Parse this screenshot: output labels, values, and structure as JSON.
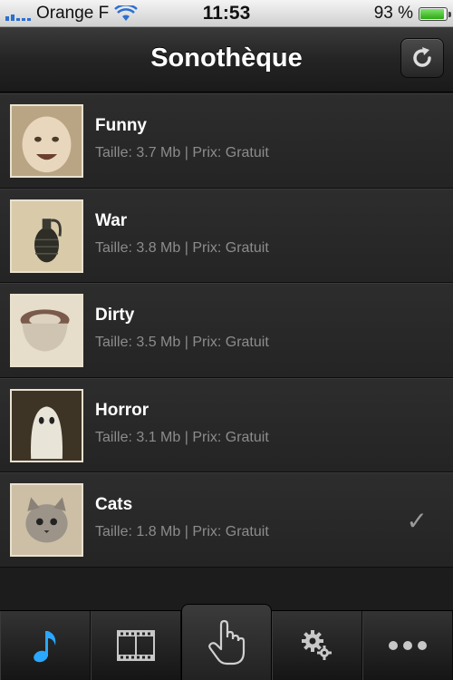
{
  "status_bar": {
    "carrier": "Orange F",
    "time": "11:53",
    "battery": "93 %",
    "battery_level": 0.93
  },
  "nav": {
    "title": "Sonothèque"
  },
  "items": [
    {
      "title": "Funny",
      "subtitle": "Taille:  3.7 Mb | Prix:  Gratuit",
      "icon": "baby-photo",
      "checked": false
    },
    {
      "title": "War",
      "subtitle": "Taille:  3.8 Mb | Prix:  Gratuit",
      "icon": "grenade-photo",
      "checked": false
    },
    {
      "title": "Dirty",
      "subtitle": "Taille:  3.5 Mb | Prix:  Gratuit",
      "icon": "toilet-photo",
      "checked": false
    },
    {
      "title": "Horror",
      "subtitle": "Taille:  3.1 Mb | Prix:  Gratuit",
      "icon": "ghost-photo",
      "checked": false
    },
    {
      "title": "Cats",
      "subtitle": "Taille:  1.8 Mb | Prix:  Gratuit",
      "icon": "cat-photo",
      "checked": true,
      "check_mark": "✓"
    }
  ],
  "tab_bar": {
    "tabs": [
      {
        "icon": "music-note-icon",
        "active": true
      },
      {
        "icon": "film-icon"
      },
      {
        "icon": "hand-pointer-icon"
      },
      {
        "icon": "gears-icon"
      },
      {
        "icon": "more-icon"
      }
    ],
    "accent_color": "#2aa7ff"
  }
}
